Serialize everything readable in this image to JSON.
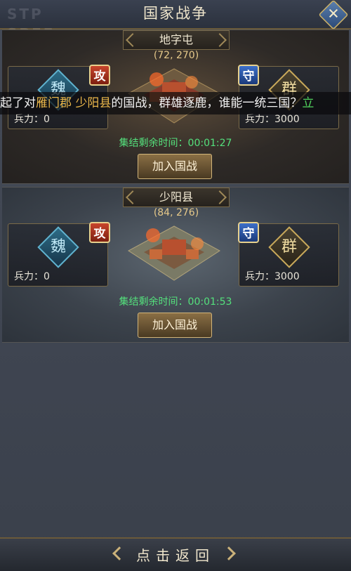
{
  "header": {
    "title": "国家战争",
    "logo_text": "STP SPEF",
    "close_label": "✕"
  },
  "ticker": {
    "prefix": "起了对",
    "city1": "雁门郡",
    "space": " ",
    "city2": "少阳县",
    "mid": "的国战，群雄逐鹿，谁能一统三国？",
    "link": "立"
  },
  "battles": [
    {
      "name": "地字屯",
      "coords": "(72, 270)",
      "attacker": {
        "faction": "魏",
        "badge": "攻",
        "troops": "兵力：0"
      },
      "defender": {
        "faction": "群",
        "badge": "守",
        "troops": "兵力：3000"
      },
      "timer": "集结剩余时间：00:01:27",
      "join_label": "加入国战"
    },
    {
      "name": "少阳县",
      "coords": "(84, 276)",
      "attacker": {
        "faction": "魏",
        "badge": "攻",
        "troops": "兵力：0"
      },
      "defender": {
        "faction": "群",
        "badge": "守",
        "troops": "兵力：3000"
      },
      "timer": "集结剩余时间：00:01:53",
      "join_label": "加入国战"
    }
  ],
  "footer": {
    "back_label": "点击返回"
  },
  "colors": {
    "timer": "#54e07c",
    "highlight": "#e9b64a",
    "link": "#52d65e",
    "attack": "#c8452c",
    "defend": "#3d6fc8"
  }
}
